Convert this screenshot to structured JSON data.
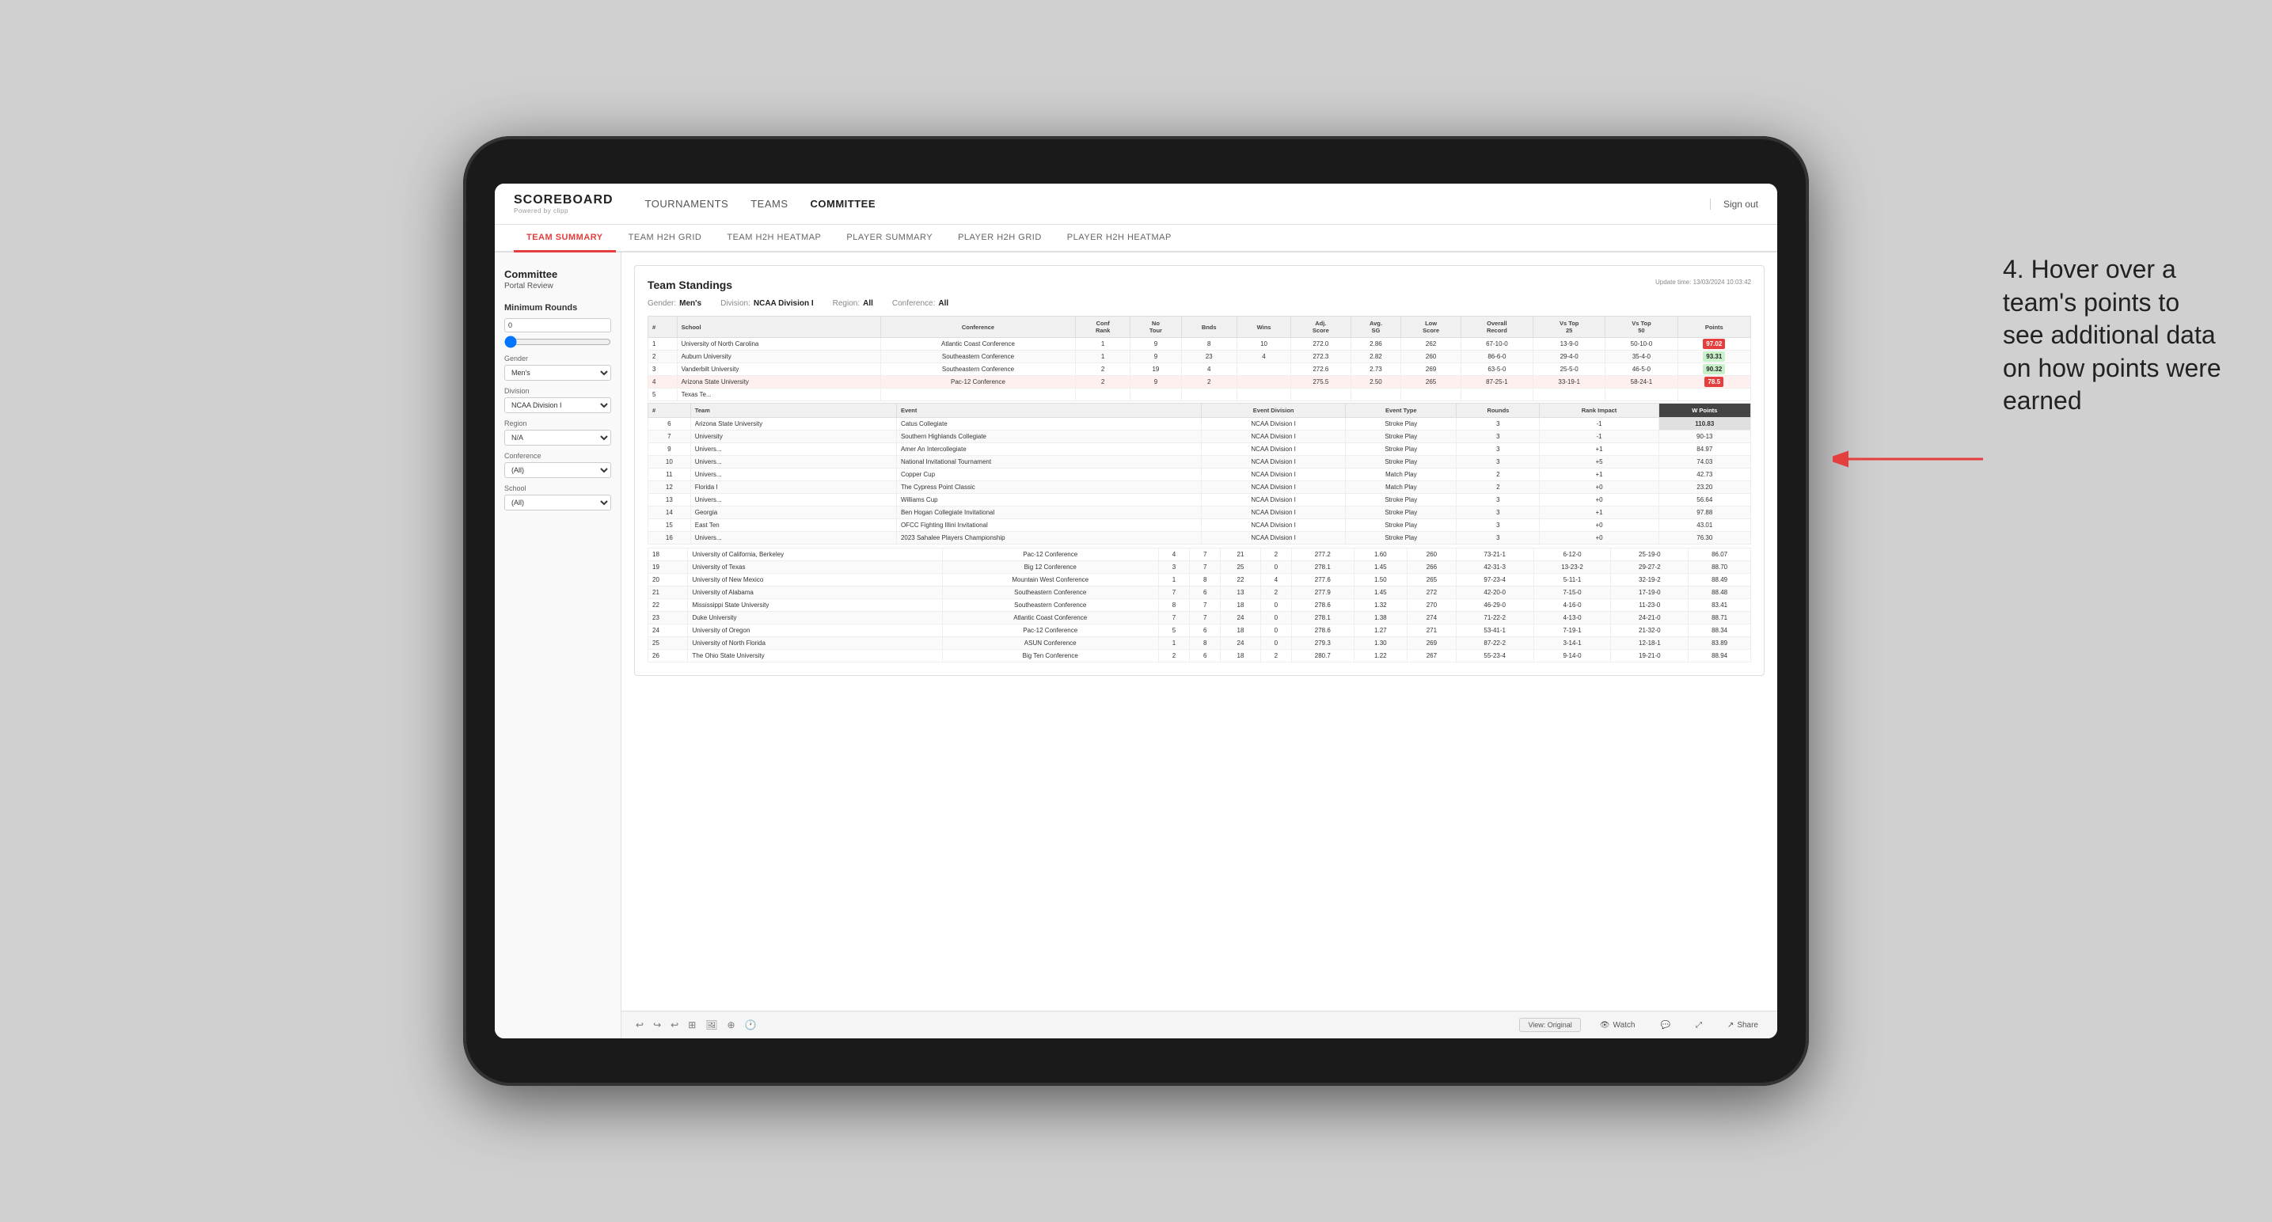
{
  "app": {
    "logo": "SCOREBOARD",
    "logo_sub": "Powered by clipp",
    "sign_out": "Sign out",
    "nav": [
      {
        "label": "TOURNAMENTS",
        "active": false
      },
      {
        "label": "TEAMS",
        "active": false
      },
      {
        "label": "COMMITTEE",
        "active": true
      }
    ],
    "sub_nav": [
      {
        "label": "TEAM SUMMARY",
        "active": true
      },
      {
        "label": "TEAM H2H GRID",
        "active": false
      },
      {
        "label": "TEAM H2H HEATMAP",
        "active": false
      },
      {
        "label": "PLAYER SUMMARY",
        "active": false
      },
      {
        "label": "PLAYER H2H GRID",
        "active": false
      },
      {
        "label": "PLAYER H2H HEATMAP",
        "active": false
      }
    ]
  },
  "sidebar": {
    "portal_title": "Committee",
    "portal_sub": "Portal Review",
    "min_rounds_label": "Minimum Rounds",
    "min_rounds_value": "0",
    "gender_label": "Gender",
    "gender_value": "Men's",
    "division_label": "Division",
    "division_value": "NCAA Division I",
    "region_label": "Region",
    "region_value": "N/A",
    "conference_label": "Conference",
    "conference_value": "(All)",
    "school_label": "School",
    "school_value": "(All)"
  },
  "report": {
    "title": "Team Standings",
    "update_time": "Update time:",
    "update_value": "13/03/2024 10:03:42",
    "filters": {
      "gender_label": "Gender:",
      "gender_value": "Men's",
      "division_label": "Division:",
      "division_value": "NCAA Division I",
      "region_label": "Region:",
      "region_value": "All",
      "conference_label": "Conference:",
      "conference_value": "All"
    }
  },
  "main_table": {
    "headers": [
      "#",
      "School",
      "Conference",
      "Conf Rank",
      "No Tour",
      "Bnds",
      "Wins",
      "Adj. Score",
      "Avg. SG",
      "Low Score",
      "Overall Record",
      "Vs Top 25",
      "Vs Top 50",
      "Points"
    ],
    "rows": [
      {
        "rank": "1",
        "school": "University of North Carolina",
        "conference": "Atlantic Coast Conference",
        "conf_rank": "1",
        "no_tour": "9",
        "bnds": "8",
        "wins": "10",
        "adj_score": "272.0",
        "avg_sg": "2.86",
        "low_score": "262",
        "overall": "67-10-0",
        "vs25": "13-9-0",
        "vs50": "50-10-0",
        "points": "97.02",
        "highlight": true
      },
      {
        "rank": "2",
        "school": "Auburn University",
        "conference": "Southeastern Conference",
        "conf_rank": "1",
        "no_tour": "9",
        "bnds": "23",
        "wins": "4",
        "adj_score": "272.3",
        "avg_sg": "2.82",
        "low_score": "260",
        "overall": "86-6-0",
        "vs25": "29-4-0",
        "vs50": "35-4-0",
        "points": "93.31"
      },
      {
        "rank": "3",
        "school": "Vanderbilt University",
        "conference": "Southeastern Conference",
        "conf_rank": "2",
        "no_tour": "19",
        "bnds": "4",
        "wins": "",
        "adj_score": "272.6",
        "avg_sg": "2.73",
        "low_score": "269",
        "overall": "63-5-0",
        "vs25": "25-5-0",
        "vs50": "46-5-0",
        "points": "90.32"
      },
      {
        "rank": "4",
        "school": "Arizona State University",
        "conference": "Pac-12 Conference",
        "conf_rank": "2",
        "no_tour": "9",
        "bnds": "2",
        "wins": "",
        "adj_score": "275.5",
        "avg_sg": "2.50",
        "low_score": "265",
        "overall": "87-25-1",
        "vs25": "33-19-1",
        "vs50": "58-24-1",
        "points": "78.5",
        "selected": true
      },
      {
        "rank": "5",
        "school": "Texas Te...",
        "conference": "",
        "conf_rank": "",
        "no_tour": "",
        "bnds": "",
        "wins": "",
        "adj_score": "",
        "avg_sg": "",
        "low_score": "",
        "overall": "",
        "vs25": "",
        "vs50": "",
        "points": ""
      }
    ],
    "overlay_rows": [
      {
        "team": "Arizona State University",
        "event": "Catus Collegiate",
        "event_division": "NCAA Division I",
        "event_type": "Stroke Play",
        "rounds": "3",
        "rank_impact": "-1",
        "w_points": "110.83"
      },
      {
        "team": "University",
        "event": "Southern Highlands Collegiate",
        "event_division": "NCAA Division I",
        "event_type": "Stroke Play",
        "rounds": "3",
        "rank_impact": "-1",
        "w_points": "90-13"
      },
      {
        "team": "Univers...",
        "event": "Amer An Intercollegiate",
        "event_division": "NCAA Division I",
        "event_type": "Stroke Play",
        "rounds": "3",
        "rank_impact": "+1",
        "w_points": "84.97"
      },
      {
        "team": "Univers...",
        "event": "National Invitational Tournament",
        "event_division": "NCAA Division I",
        "event_type": "Stroke Play",
        "rounds": "3",
        "rank_impact": "+5",
        "w_points": "74.03"
      },
      {
        "team": "Univers...",
        "event": "Copper Cup",
        "event_division": "NCAA Division I",
        "event_type": "Match Play",
        "rounds": "2",
        "rank_impact": "+1",
        "w_points": "42.73"
      },
      {
        "team": "Florida I",
        "event": "The Cypress Point Classic",
        "event_division": "NCAA Division I",
        "event_type": "Match Play",
        "rounds": "2",
        "rank_impact": "+0",
        "w_points": "23.20"
      },
      {
        "team": "Univers...",
        "event": "Williams Cup",
        "event_division": "NCAA Division I",
        "event_type": "Stroke Play",
        "rounds": "3",
        "rank_impact": "+0",
        "w_points": "56.64"
      },
      {
        "team": "Georgia",
        "event": "Ben Hogan Collegiate Invitational",
        "event_division": "NCAA Division I",
        "event_type": "Stroke Play",
        "rounds": "3",
        "rank_impact": "+1",
        "w_points": "97.88"
      },
      {
        "team": "East Ten",
        "event": "OFCC Fighting Illini Invitational",
        "event_division": "NCAA Division I",
        "event_type": "Stroke Play",
        "rounds": "3",
        "rank_impact": "+0",
        "w_points": "43.01"
      },
      {
        "team": "Univers...",
        "event": "2023 Sahalee Players Championship",
        "event_division": "NCAA Division I",
        "event_type": "Stroke Play",
        "rounds": "3",
        "rank_impact": "+0",
        "w_points": "76.30"
      }
    ],
    "lower_rows": [
      {
        "rank": "18",
        "school": "University of California, Berkeley",
        "conference": "Pac-12 Conference",
        "conf_rank": "4",
        "no_tour": "7",
        "bnds": "21",
        "wins": "2",
        "adj_score": "277.2",
        "avg_sg": "1.60",
        "low_score": "260",
        "overall": "73-21-1",
        "vs25": "6-12-0",
        "vs50": "25-19-0",
        "points": "86.07"
      },
      {
        "rank": "19",
        "school": "University of Texas",
        "conference": "Big 12 Conference",
        "conf_rank": "3",
        "no_tour": "7",
        "bnds": "25",
        "wins": "0",
        "adj_score": "278.1",
        "avg_sg": "1.45",
        "low_score": "266",
        "overall": "42-31-3",
        "vs25": "13-23-2",
        "vs50": "29-27-2",
        "points": "88.70"
      },
      {
        "rank": "20",
        "school": "University of New Mexico",
        "conference": "Mountain West Conference",
        "conf_rank": "1",
        "no_tour": "8",
        "bnds": "22",
        "wins": "4",
        "adj_score": "277.6",
        "avg_sg": "1.50",
        "low_score": "265",
        "overall": "97-23-4",
        "vs25": "5-11-1",
        "vs50": "32-19-2",
        "points": "88.49"
      },
      {
        "rank": "21",
        "school": "University of Alabama",
        "conference": "Southeastern Conference",
        "conf_rank": "7",
        "no_tour": "6",
        "bnds": "13",
        "wins": "2",
        "adj_score": "277.9",
        "avg_sg": "1.45",
        "low_score": "272",
        "overall": "42-20-0",
        "vs25": "7-15-0",
        "vs50": "17-19-0",
        "points": "88.48"
      },
      {
        "rank": "22",
        "school": "Mississippi State University",
        "conference": "Southeastern Conference",
        "conf_rank": "8",
        "no_tour": "7",
        "bnds": "18",
        "wins": "0",
        "adj_score": "278.6",
        "avg_sg": "1.32",
        "low_score": "270",
        "overall": "46-29-0",
        "vs25": "4-16-0",
        "vs50": "11-23-0",
        "points": "83.41"
      },
      {
        "rank": "23",
        "school": "Duke University",
        "conference": "Atlantic Coast Conference",
        "conf_rank": "7",
        "no_tour": "7",
        "bnds": "24",
        "wins": "0",
        "adj_score": "278.1",
        "avg_sg": "1.38",
        "low_score": "274",
        "overall": "71-22-2",
        "vs25": "4-13-0",
        "vs50": "24-21-0",
        "points": "88.71"
      },
      {
        "rank": "24",
        "school": "University of Oregon",
        "conference": "Pac-12 Conference",
        "conf_rank": "5",
        "no_tour": "6",
        "bnds": "18",
        "wins": "0",
        "adj_score": "278.6",
        "avg_sg": "1.27",
        "low_score": "271",
        "overall": "53-41-1",
        "vs25": "7-19-1",
        "vs50": "21-32-0",
        "points": "88.34"
      },
      {
        "rank": "25",
        "school": "University of North Florida",
        "conference": "ASUN Conference",
        "conf_rank": "1",
        "no_tour": "8",
        "bnds": "24",
        "wins": "0",
        "adj_score": "279.3",
        "avg_sg": "1.30",
        "low_score": "269",
        "overall": "87-22-2",
        "vs25": "3-14-1",
        "vs50": "12-18-1",
        "points": "83.89"
      },
      {
        "rank": "26",
        "school": "The Ohio State University",
        "conference": "Big Ten Conference",
        "conf_rank": "2",
        "no_tour": "6",
        "bnds": "18",
        "wins": "2",
        "adj_score": "280.7",
        "avg_sg": "1.22",
        "low_score": "267",
        "overall": "55-23-4",
        "vs25": "9-14-0",
        "vs50": "19-21-0",
        "points": "88.94"
      }
    ]
  },
  "toolbar": {
    "view_original": "View: Original",
    "watch": "Watch",
    "share": "Share",
    "icons": [
      "↩",
      "↪",
      "↩",
      "⊞",
      "🖼",
      "⊕",
      "🕐"
    ]
  },
  "annotation": {
    "text": "4. Hover over a team's points to see additional data on how points were earned",
    "arrow": "→"
  }
}
